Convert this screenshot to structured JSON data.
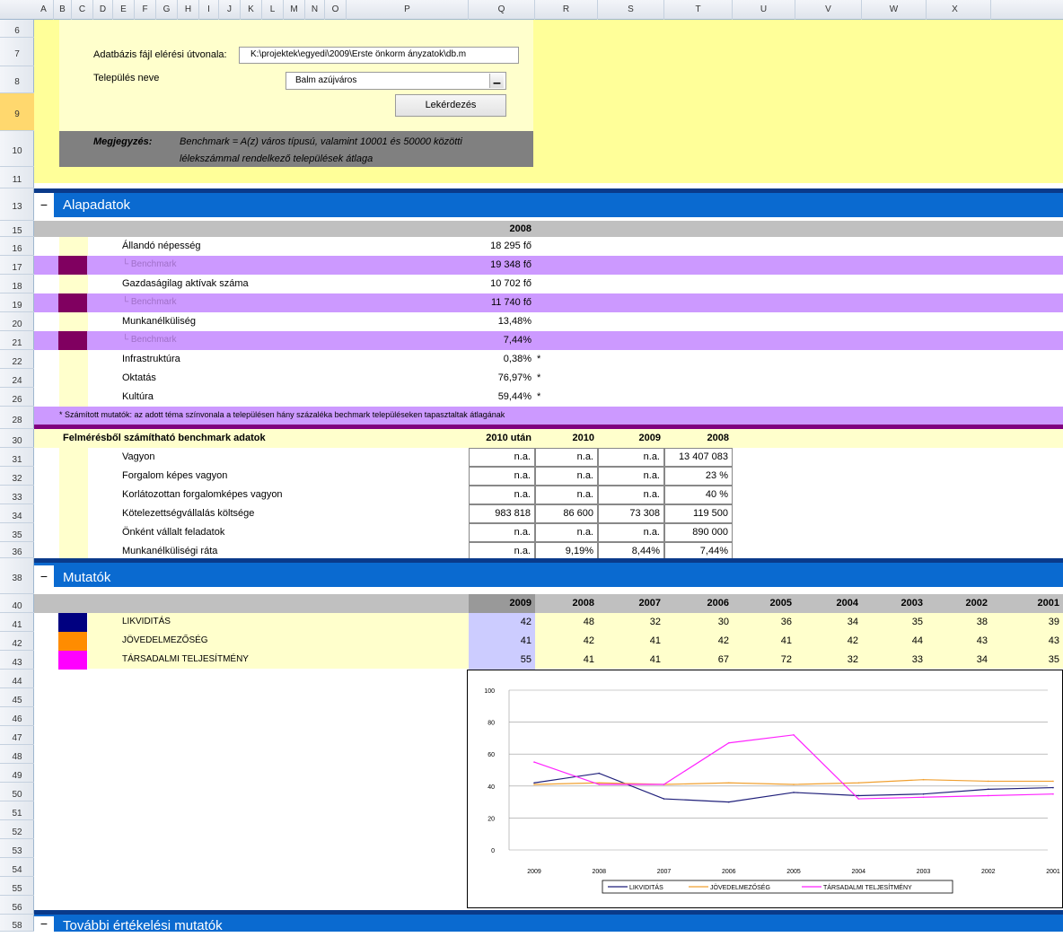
{
  "columns": [
    "A",
    "B",
    "C",
    "D",
    "E",
    "F",
    "G",
    "H",
    "I",
    "J",
    "K",
    "L",
    "M",
    "N",
    "O",
    "P",
    "Q",
    "R",
    "S",
    "T",
    "U",
    "V",
    "W",
    "X"
  ],
  "rows": [
    "6",
    "7",
    "8",
    "9",
    "10",
    "11",
    "13",
    "15",
    "16",
    "17",
    "18",
    "19",
    "20",
    "21",
    "22",
    "24",
    "26",
    "28",
    "30",
    "31",
    "32",
    "33",
    "34",
    "35",
    "36",
    "38",
    "40",
    "41",
    "42",
    "43",
    "44",
    "45",
    "46",
    "47",
    "48",
    "49",
    "50",
    "51",
    "52",
    "53",
    "54",
    "55",
    "56",
    "58"
  ],
  "form": {
    "path_label": "Adatbázis fájl elérési útvonala:",
    "path_value": "K:\\projektek\\egyedi\\2009\\Erste önkorm ányzatok\\db.m",
    "settlement_label": "Település neve",
    "settlement_value": "Balm azújváros",
    "query_button": "Lekérdezés",
    "note_label": "Megjegyzés:",
    "note_line1": "Benchmark = A(z) város típusú, valamint 10001 és 50000 közötti",
    "note_line2": "lélekszámmal rendelkező települések átlaga"
  },
  "section1": {
    "title": "Alapadatok",
    "minus": "−",
    "year": "2008",
    "rows": [
      {
        "label": "Állandó népesség",
        "value": "18 295 fő",
        "star": ""
      },
      {
        "label": "└ Benchmark",
        "value": "19 348 fő",
        "star": ""
      },
      {
        "label": "Gazdaságilag aktívak száma",
        "value": "10 702 fő",
        "star": ""
      },
      {
        "label": "└ Benchmark",
        "value": "11 740 fő",
        "star": ""
      },
      {
        "label": "Munkanélküliség",
        "value": "13,48%",
        "star": ""
      },
      {
        "label": "└ Benchmark",
        "value": "7,44%",
        "star": ""
      },
      {
        "label": "Infrastruktúra",
        "value": "0,38%",
        "star": "*"
      },
      {
        "label": "Oktatás",
        "value": "76,97%",
        "star": "*"
      },
      {
        "label": "Kultúra",
        "value": "59,44%",
        "star": "*"
      }
    ],
    "footnote": "* Számított mutatók: az adott téma színvonala a településen hány százaléka bechmark településeken tapasztaltak átlagának"
  },
  "survey": {
    "title": "Felmérésből számítható benchmark adatok",
    "headers": [
      "2010 után",
      "2010",
      "2009",
      "2008"
    ],
    "rows": [
      {
        "label": "Vagyon",
        "v": [
          "n.a.",
          "n.a.",
          "n.a.",
          "13 407 083"
        ]
      },
      {
        "label": "Forgalom képes vagyon",
        "v": [
          "n.a.",
          "n.a.",
          "n.a.",
          "23 %"
        ]
      },
      {
        "label": "Korlátozottan forgalomképes vagyon",
        "v": [
          "n.a.",
          "n.a.",
          "n.a.",
          "40 %"
        ]
      },
      {
        "label": "Kötelezettségvállalás költsége",
        "v": [
          "983 818",
          "86 600",
          "73 308",
          "119 500"
        ]
      },
      {
        "label": "Önként vállalt feladatok",
        "v": [
          "n.a.",
          "n.a.",
          "n.a.",
          "890 000"
        ]
      },
      {
        "label": "Munkanélküliségi ráta",
        "v": [
          "n.a.",
          "9,19%",
          "8,44%",
          "7,44%"
        ]
      }
    ]
  },
  "section2": {
    "title": "Mutatók",
    "minus": "−",
    "years": [
      "2009",
      "2008",
      "2007",
      "2006",
      "2005",
      "2004",
      "2003",
      "2002",
      "2001"
    ],
    "rows": [
      {
        "label": "LIKVIDITÁS",
        "color": "#000080",
        "v": [
          "42",
          "48",
          "32",
          "30",
          "36",
          "34",
          "35",
          "38",
          "39"
        ]
      },
      {
        "label": "JÖVEDELMEZŐSÉG",
        "color": "#ff8c00",
        "v": [
          "41",
          "42",
          "41",
          "42",
          "41",
          "42",
          "44",
          "43",
          "43"
        ]
      },
      {
        "label": "TÁRSADALMI TELJESÍTMÉNY",
        "color": "#ff00ff",
        "v": [
          "55",
          "41",
          "41",
          "67",
          "72",
          "32",
          "33",
          "34",
          "35"
        ]
      }
    ]
  },
  "chart_data": {
    "type": "line",
    "categories": [
      "2009",
      "2008",
      "2007",
      "2006",
      "2005",
      "2004",
      "2003",
      "2002",
      "2001"
    ],
    "ylim": [
      0,
      100
    ],
    "yticks": [
      "100",
      "80",
      "60",
      "40",
      "20",
      "0"
    ],
    "legend_position": "bottom",
    "series": [
      {
        "name": "LIKVIDITÁS",
        "color": "#1f1f7a",
        "values": [
          42,
          48,
          32,
          30,
          36,
          34,
          35,
          38,
          39
        ]
      },
      {
        "name": "JÖVEDELMEZŐSÉG",
        "color": "#f0a030",
        "values": [
          41,
          42,
          41,
          42,
          41,
          42,
          44,
          43,
          43
        ]
      },
      {
        "name": "TÁRSADALMI TELJESÍTMÉNY",
        "color": "#ff22ff",
        "values": [
          55,
          41,
          41,
          67,
          72,
          32,
          33,
          34,
          35
        ]
      }
    ]
  },
  "section3": {
    "title": "További értékelési mutatók",
    "minus": "−"
  }
}
